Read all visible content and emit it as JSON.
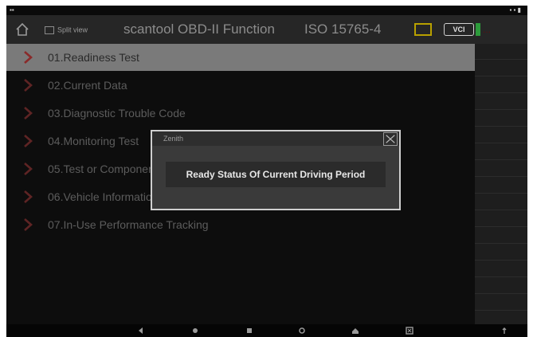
{
  "status_bar": {
    "left": "▪▪",
    "right": "▪ ▪ ▮"
  },
  "title_bar": {
    "split_view_label": "Split view",
    "title": "scantool OBD-II Function",
    "protocol": "ISO 15765-4",
    "vci_label": "VCI",
    "vin": "...",
    "colors": {
      "background": "#262626",
      "report_icon": "#b8a000",
      "wifi": "#2d9b3b"
    }
  },
  "menu": {
    "selected_index": 0,
    "items": [
      {
        "label": "01.Readiness Test"
      },
      {
        "label": "02.Current Data"
      },
      {
        "label": "03.Diagnostic Trouble Code"
      },
      {
        "label": "04.Monitoring Test"
      },
      {
        "label": "05.Test or Component"
      },
      {
        "label": "06.Vehicle Information"
      },
      {
        "label": "07.In-Use Performance Tracking"
      }
    ],
    "colors": {
      "chevron": "#7a2a2a",
      "selected_bg": "#7a7a7a"
    }
  },
  "dialog": {
    "title": "Zenith",
    "option_label": "Ready Status Of Current Driving Period"
  },
  "nav_bar": {
    "icons": [
      "back-icon",
      "home-icon",
      "recents-icon",
      "settings-icon",
      "home-shortcut-icon",
      "screenshot-icon",
      "menu-icon"
    ]
  }
}
